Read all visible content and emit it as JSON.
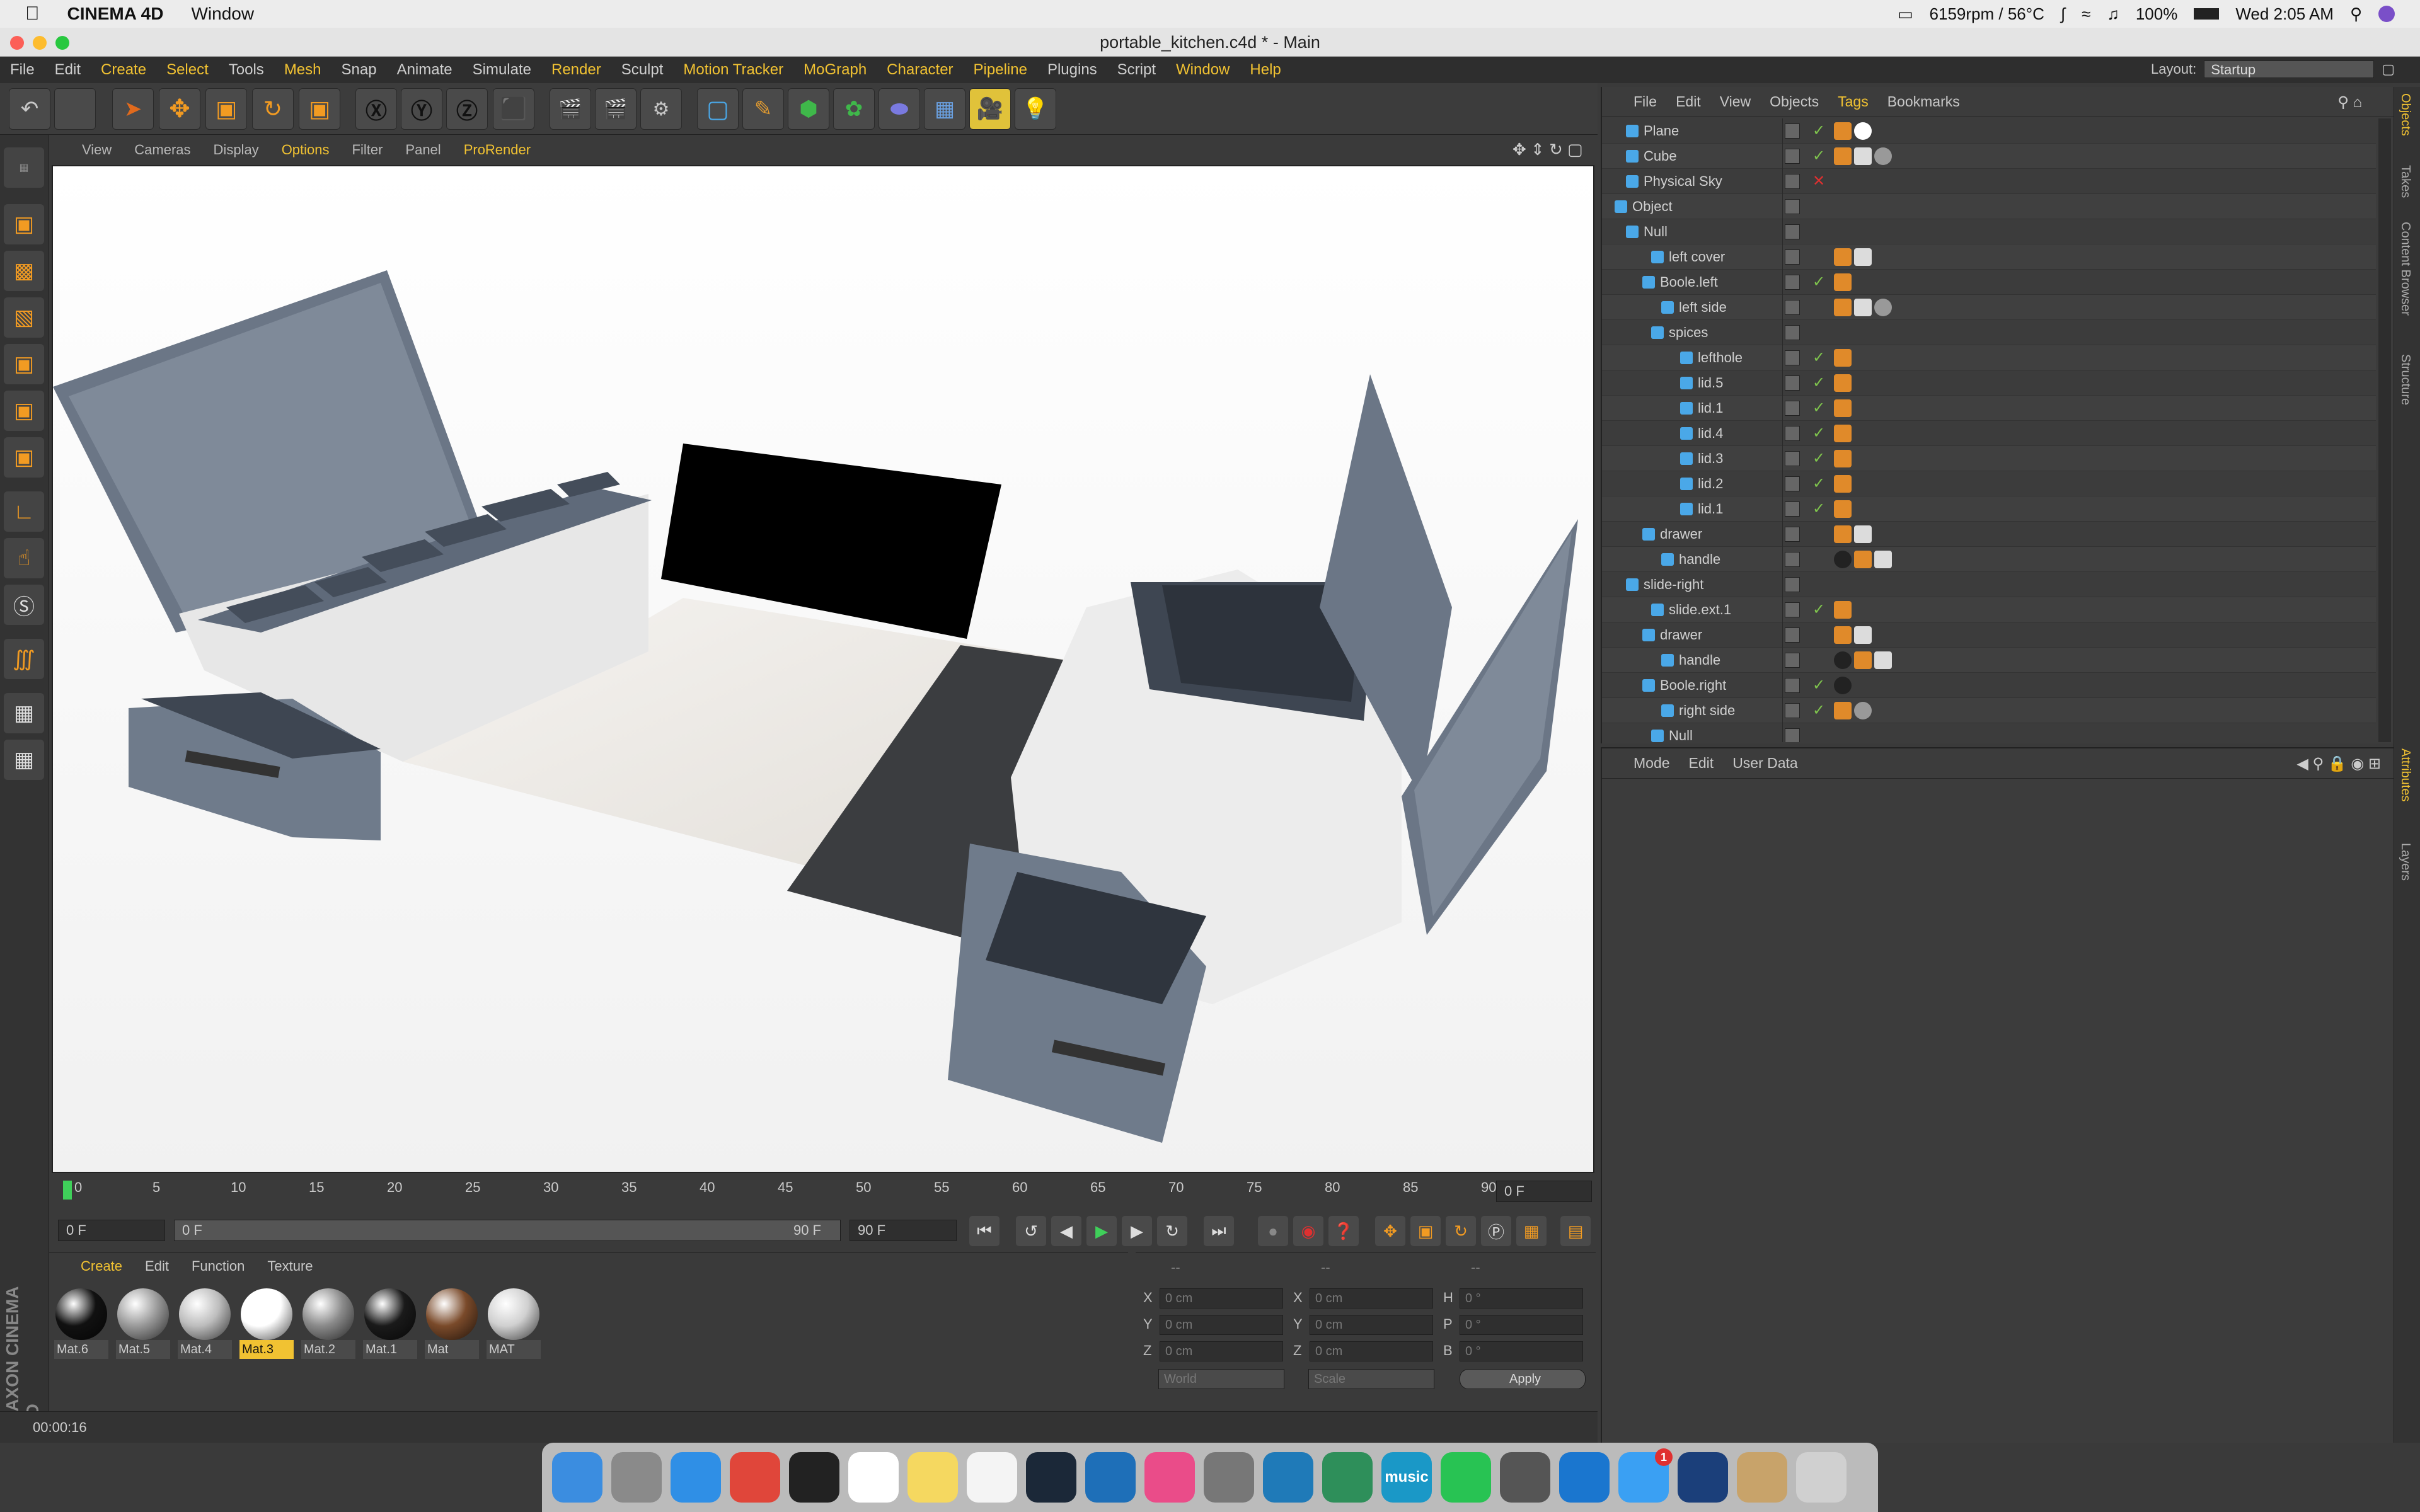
{
  "macbar": {
    "app_name": "CINEMA 4D",
    "window_menu": "Window",
    "cpu_status": "6159rpm / 56°C",
    "battery": "100%",
    "clock": "Wed 2:05 AM"
  },
  "window": {
    "title": "portable_kitchen.c4d * - Main"
  },
  "menu": [
    "File",
    "Edit",
    "Create",
    "Select",
    "Tools",
    "Mesh",
    "Snap",
    "Animate",
    "Simulate",
    "Render",
    "Sculpt",
    "Motion Tracker",
    "MoGraph",
    "Character",
    "Pipeline",
    "Plugins",
    "Script",
    "Window",
    "Help"
  ],
  "menu_highlight": [
    "Create",
    "Select",
    "Mesh",
    "Render",
    "Motion Tracker",
    "MoGraph",
    "Character",
    "Pipeline",
    "Window",
    "Help"
  ],
  "layout": {
    "label": "Layout:",
    "value": "Startup"
  },
  "viewport_menu": [
    "View",
    "Cameras",
    "Display",
    "Options",
    "Filter",
    "Panel",
    "ProRender"
  ],
  "timeline": {
    "ticks": [
      "0",
      "5",
      "10",
      "15",
      "20",
      "25",
      "30",
      "35",
      "40",
      "45",
      "50",
      "55",
      "60",
      "65",
      "70",
      "75",
      "80",
      "85",
      "90"
    ],
    "current_frame": "0 F"
  },
  "controls": {
    "start": "0 F",
    "range_start": "0 F",
    "range_end": "90 F",
    "end": "90 F"
  },
  "materials": {
    "tabs": [
      "Create",
      "Edit",
      "Function",
      "Texture"
    ],
    "items": [
      {
        "name": "Mat.6",
        "color": "#111111"
      },
      {
        "name": "Mat.5",
        "color": "#9a9a9a"
      },
      {
        "name": "Mat.4",
        "color": "#bdbdbd"
      },
      {
        "name": "Mat.3",
        "color": "#ffffff",
        "selected": true
      },
      {
        "name": "Mat.2",
        "color": "#8a8a8a"
      },
      {
        "name": "Mat.1",
        "color": "#1a1a1a"
      },
      {
        "name": "Mat",
        "color": "#7a4a2a"
      },
      {
        "name": "MAT",
        "color": "#d0d0d0"
      }
    ]
  },
  "coords": {
    "headers": [
      "--",
      "--",
      "--"
    ],
    "rows": [
      {
        "a": "X",
        "av": "0 cm",
        "b": "X",
        "bv": "0 cm",
        "c": "H",
        "cv": "0 °"
      },
      {
        "a": "Y",
        "av": "0 cm",
        "b": "Y",
        "bv": "0 cm",
        "c": "P",
        "cv": "0 °"
      },
      {
        "a": "Z",
        "av": "0 cm",
        "b": "Z",
        "bv": "0 cm",
        "c": "B",
        "cv": "0 °"
      }
    ],
    "world": "World",
    "scale": "Scale",
    "apply": "Apply"
  },
  "status": {
    "time": "00:00:16"
  },
  "objects_tabs": [
    "File",
    "Edit",
    "View",
    "Objects",
    "Tags",
    "Bookmarks"
  ],
  "objects": [
    {
      "name": "Plane",
      "check": "✓"
    },
    {
      "name": "Cube",
      "check": "✓"
    },
    {
      "name": "Physical Sky",
      "check": "✕"
    },
    {
      "name": "Object",
      "check": ""
    },
    {
      "name": "Null",
      "check": ""
    },
    {
      "name": "left cover",
      "check": ""
    },
    {
      "name": "Boole.left",
      "check": "✓"
    },
    {
      "name": "left side",
      "check": ""
    },
    {
      "name": "spices",
      "check": ""
    },
    {
      "name": "lefthole",
      "check": "✓"
    },
    {
      "name": "lid.5",
      "check": "✓"
    },
    {
      "name": "lid.1",
      "check": "✓"
    },
    {
      "name": "lid.4",
      "check": "✓"
    },
    {
      "name": "lid.3",
      "check": "✓"
    },
    {
      "name": "lid.2",
      "check": "✓"
    },
    {
      "name": "lid.1",
      "check": "✓"
    },
    {
      "name": "drawer",
      "check": ""
    },
    {
      "name": "handle",
      "check": ""
    },
    {
      "name": "slide-right",
      "check": ""
    },
    {
      "name": "slide.ext.1",
      "check": "✓"
    },
    {
      "name": "drawer",
      "check": ""
    },
    {
      "name": "handle",
      "check": ""
    },
    {
      "name": "Boole.right",
      "check": "✓"
    },
    {
      "name": "right side",
      "check": "✓"
    },
    {
      "name": "Null",
      "check": ""
    }
  ],
  "attr_tabs": [
    "Mode",
    "Edit",
    "User Data"
  ],
  "side_tabs": [
    "Objects",
    "Takes",
    "Content Browser",
    "Structure"
  ],
  "side_tabs_lower": [
    "Attributes",
    "Layers"
  ],
  "dock": [
    {
      "name": "Finder",
      "color": "#3b8de0"
    },
    {
      "name": "Launchpad",
      "color": "#8a8a8a"
    },
    {
      "name": "Safari",
      "color": "#2f8fe6"
    },
    {
      "name": "Chrome",
      "color": "#e0463a"
    },
    {
      "name": "Terminal",
      "color": "#222222"
    },
    {
      "name": "Calendar",
      "color": "#ffffff"
    },
    {
      "name": "Notes",
      "color": "#f5d860"
    },
    {
      "name": "Reminders",
      "color": "#f4f4f4"
    },
    {
      "name": "Steam",
      "color": "#1b2838"
    },
    {
      "name": "VS Code",
      "color": "#1e6fb8"
    },
    {
      "name": "iTunes",
      "color": "#ea4c89"
    },
    {
      "name": "System Prefs",
      "color": "#777777"
    },
    {
      "name": "Box",
      "color": "#1f7ab8"
    },
    {
      "name": "Atom",
      "color": "#2e8f5a"
    },
    {
      "name": "Amazon Music",
      "color": "#1a98c7"
    },
    {
      "name": "WhatsApp",
      "color": "#28c353"
    },
    {
      "name": "Utility",
      "color": "#555555"
    },
    {
      "name": "Trello",
      "color": "#1a76cf"
    },
    {
      "name": "Messages",
      "color": "#3aa0f3"
    },
    {
      "name": "Cinema 4D",
      "color": "#1b3f7a"
    },
    {
      "name": "Folder",
      "color": "#c8a36a"
    },
    {
      "name": "Trash",
      "color": "#d0d0d0"
    }
  ],
  "dock_labels": {
    "music": "music",
    "badge": "1"
  }
}
